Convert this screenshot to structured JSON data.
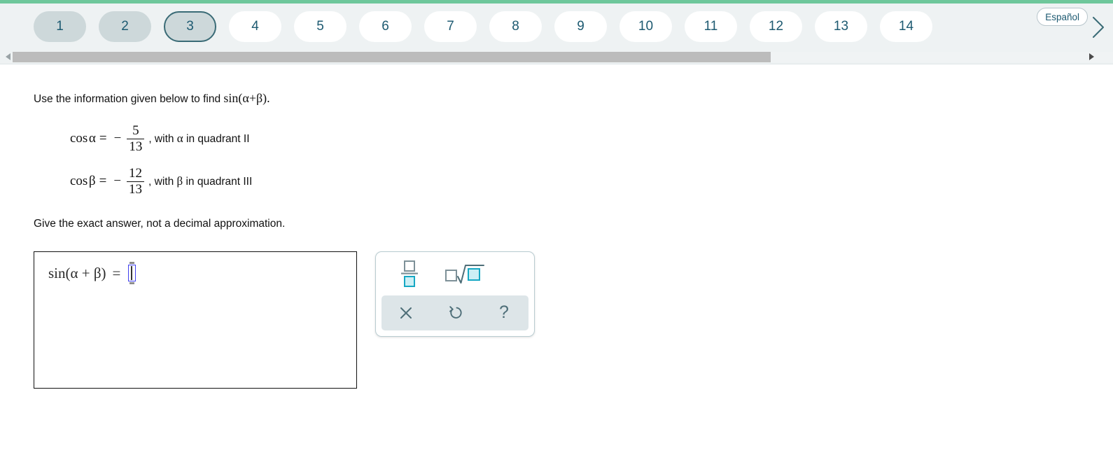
{
  "theme": {
    "accent_green": "#6ec79b",
    "header_bg": "#eef2f3",
    "tab_visited_bg": "#cdd8da",
    "tab_current_border": "#3a6b76",
    "tab_text": "#1d5a71",
    "palette_highlight": "#16a8c4",
    "input_border": "#4040ef"
  },
  "header": {
    "tabs": [
      {
        "label": "1",
        "state": "visited"
      },
      {
        "label": "2",
        "state": "visited"
      },
      {
        "label": "3",
        "state": "current"
      },
      {
        "label": "4",
        "state": "unvisited"
      },
      {
        "label": "5",
        "state": "unvisited"
      },
      {
        "label": "6",
        "state": "unvisited"
      },
      {
        "label": "7",
        "state": "unvisited"
      },
      {
        "label": "8",
        "state": "unvisited"
      },
      {
        "label": "9",
        "state": "unvisited"
      },
      {
        "label": "10",
        "state": "unvisited"
      },
      {
        "label": "11",
        "state": "unvisited"
      },
      {
        "label": "12",
        "state": "unvisited"
      },
      {
        "label": "13",
        "state": "unvisited"
      },
      {
        "label": "14",
        "state": "unvisited"
      }
    ],
    "language_button": "Español",
    "next_icon": "chevron-right-icon"
  },
  "scrollbar": {
    "left_arrow_icon": "triangle-left-icon",
    "right_arrow_icon": "triangle-right-icon"
  },
  "question": {
    "prompt_text": "Use the information given below to find",
    "prompt_math": "sin(α+β).",
    "given": [
      {
        "function": "cos",
        "variable": "α",
        "equals": "=",
        "minus": "−",
        "numerator": "5",
        "denominator": "13",
        "comma": ",",
        "tail_prefix": "with",
        "tail_variable": "α",
        "tail_suffix": "in quadrant II"
      },
      {
        "function": "cos",
        "variable": "β",
        "equals": "=",
        "minus": "−",
        "numerator": "12",
        "denominator": "13",
        "comma": ",",
        "tail_prefix": "with",
        "tail_variable": "β",
        "tail_suffix": "in quadrant III"
      }
    ],
    "note": "Give the exact answer, not a decimal approximation."
  },
  "answer": {
    "expression_lhs": "sin(α + β)",
    "equals": "=",
    "value": ""
  },
  "palette": {
    "fraction_button": {
      "name": "fraction-icon",
      "numerator_placeholder": "□",
      "denominator_placeholder": "□"
    },
    "root_button": {
      "name": "square-root-icon",
      "index_placeholder": "□",
      "radicand_placeholder": "□"
    },
    "tools": [
      {
        "name": "clear-icon",
        "glyph": "✕",
        "label": "Clear"
      },
      {
        "name": "undo-icon",
        "glyph": "↺",
        "label": "Undo"
      },
      {
        "name": "help-icon",
        "glyph": "?",
        "label": "Help"
      }
    ]
  }
}
